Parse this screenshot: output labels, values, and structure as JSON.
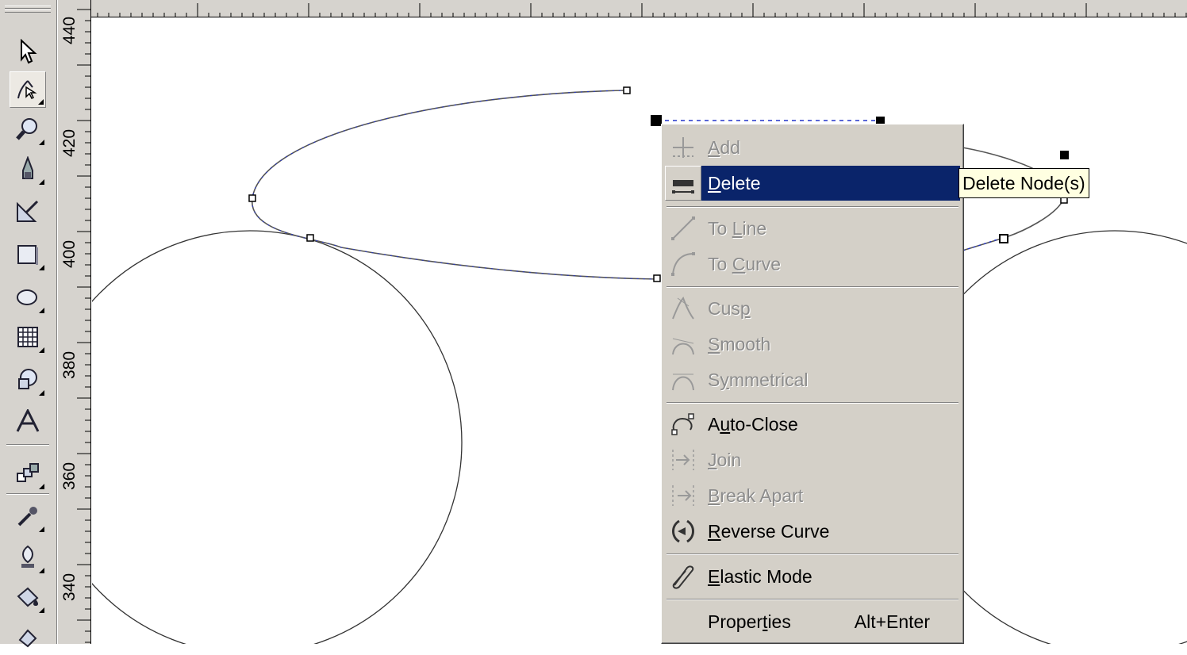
{
  "toolbox": {
    "tools": [
      {
        "name": "pick-tool-icon"
      },
      {
        "name": "shape-tool-icon",
        "active": true
      },
      {
        "name": "zoom-tool-icon"
      },
      {
        "name": "freehand-tool-icon"
      },
      {
        "name": "smart-fill-tool-icon"
      },
      {
        "name": "rectangle-tool-icon"
      },
      {
        "name": "ellipse-tool-icon"
      },
      {
        "name": "graph-paper-tool-icon"
      },
      {
        "name": "basic-shapes-tool-icon"
      },
      {
        "name": "text-tool-icon"
      },
      {
        "name": "interactive-blend-tool-icon"
      },
      {
        "name": "eyedropper-tool-icon"
      },
      {
        "name": "outline-pen-tool-icon"
      },
      {
        "name": "fill-tool-icon"
      },
      {
        "name": "interactive-fill-tool-icon"
      }
    ]
  },
  "vertical_ruler": {
    "labels": [
      "440",
      "420",
      "400",
      "380",
      "360",
      "340"
    ]
  },
  "context_menu": {
    "items": [
      {
        "label": "Add",
        "u": "A",
        "rest": "dd",
        "disabled": true,
        "icon": "add-node-icon"
      },
      {
        "label": "Delete",
        "u": "D",
        "rest": "elete",
        "selected": true,
        "icon": "delete-node-icon"
      },
      {
        "label": "To Line",
        "pre": "To ",
        "u": "L",
        "rest": "ine",
        "disabled": true,
        "icon": "to-line-icon"
      },
      {
        "label": "To Curve",
        "pre": "To ",
        "u": "C",
        "rest": "urve",
        "disabled": true,
        "icon": "to-curve-icon"
      },
      {
        "label": "Cusp",
        "pre": "Cus",
        "u": "p",
        "rest": "",
        "disabled": true,
        "icon": "cusp-icon"
      },
      {
        "label": "Smooth",
        "u": "S",
        "rest": "mooth",
        "disabled": true,
        "icon": "smooth-icon"
      },
      {
        "label": "Symmetrical",
        "pre": "S",
        "u": "y",
        "rest": "mmetrical",
        "disabled": true,
        "icon": "symmetrical-icon"
      },
      {
        "label": "Auto-Close",
        "pre": "A",
        "u": "u",
        "rest": "to-Close",
        "icon": "auto-close-icon"
      },
      {
        "label": "Join",
        "u": "J",
        "rest": "oin",
        "disabled": true,
        "icon": "join-icon"
      },
      {
        "label": "Break Apart",
        "u": "B",
        "rest": "reak Apart",
        "disabled": true,
        "icon": "break-apart-icon"
      },
      {
        "label": "Reverse Curve",
        "u": "R",
        "rest": "everse Curve",
        "icon": "reverse-curve-icon"
      },
      {
        "label": "Elastic Mode",
        "u": "E",
        "rest": "lastic Mode",
        "icon": "elastic-mode-icon"
      },
      {
        "label": "Properties",
        "pre": "Proper",
        "u": "t",
        "rest": "ies",
        "accelerator": "Alt+Enter"
      }
    ]
  },
  "tooltip": {
    "text": "Delete Node(s)"
  }
}
